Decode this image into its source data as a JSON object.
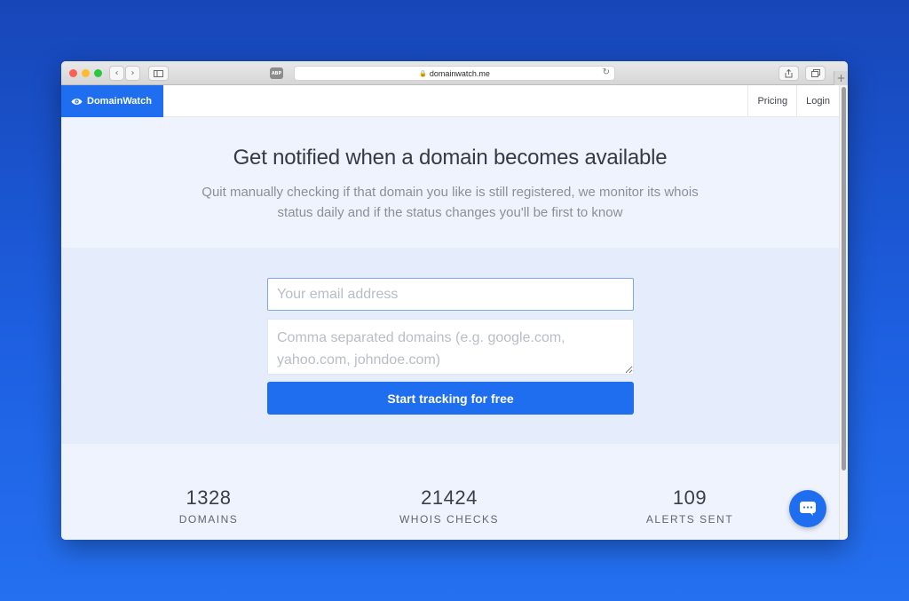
{
  "browser": {
    "url": "domainwatch.me",
    "adblock_label": "ABP",
    "plus_label": "+"
  },
  "nav": {
    "brand": "DomainWatch",
    "links": [
      "Pricing",
      "Login"
    ]
  },
  "hero": {
    "headline": "Get notified when a domain becomes available",
    "subline": "Quit manually checking if that domain you like is still registered, we monitor its whois status daily and if the status changes you'll be first to know"
  },
  "form": {
    "email_placeholder": "Your email address",
    "domains_placeholder": "Comma separated domains (e.g. google.com, yahoo.com, johndoe.com)",
    "submit_label": "Start tracking for free"
  },
  "stats": [
    {
      "value": "1328",
      "label": "DOMAINS"
    },
    {
      "value": "21424",
      "label": "WHOIS CHECKS"
    },
    {
      "value": "109",
      "label": "ALERTS SENT"
    }
  ],
  "colors": {
    "accent": "#206ef0",
    "background": "#1d5fe0"
  },
  "icons": {
    "brand": "eye-icon",
    "chat": "chat-icon"
  }
}
